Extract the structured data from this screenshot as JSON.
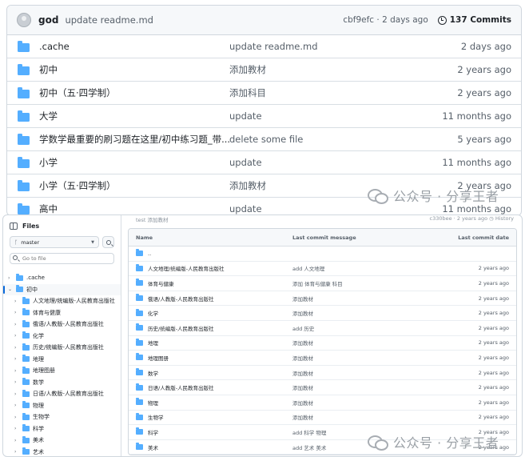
{
  "top": {
    "commit": {
      "author": "god",
      "message": "update readme.md",
      "hash_age": "cbf9efc · 2 days ago",
      "commits": "137 Commits"
    },
    "rows": [
      {
        "name": ".cache",
        "message": "update readme.md",
        "date": "2 days ago"
      },
      {
        "name": "初中",
        "message": "添加教材",
        "date": "2 years ago"
      },
      {
        "name": "初中（五·四学制）",
        "message": "添加科目",
        "date": "2 years ago"
      },
      {
        "name": "大学",
        "message": "update",
        "date": "11 months ago"
      },
      {
        "name": "学数学最重要的刷习题在这里/初中练习题_带...",
        "message": "delete some file",
        "date": "5 years ago"
      },
      {
        "name": "小学",
        "message": "update",
        "date": "11 months ago"
      },
      {
        "name": "小学（五·四学制）",
        "message": "添加教材",
        "date": "2 years ago"
      },
      {
        "name": "高中",
        "message": "update",
        "date": "11 months ago"
      }
    ]
  },
  "watermark": {
    "text": "公众号 · 分享王者"
  },
  "bottom": {
    "sidebar": {
      "title": "Files",
      "branch": "master",
      "goto_placeholder": "Go to file",
      "tree": [
        {
          "label": ".cache",
          "level": 0,
          "open": false
        },
        {
          "label": "初中",
          "level": 0,
          "open": true
        },
        {
          "label": "人文地理/统编版-人民教育出版社",
          "level": 1
        },
        {
          "label": "体育与健康",
          "level": 1
        },
        {
          "label": "俄语/人教版-人民教育出版社",
          "level": 1
        },
        {
          "label": "化学",
          "level": 1
        },
        {
          "label": "历史/统编版-人民教育出版社",
          "level": 1
        },
        {
          "label": "地理",
          "level": 1
        },
        {
          "label": "地理图册",
          "level": 1
        },
        {
          "label": "数学",
          "level": 1
        },
        {
          "label": "日语/人教版-人民教育出版社",
          "level": 1
        },
        {
          "label": "物理",
          "level": 1
        },
        {
          "label": "生物学",
          "level": 1
        },
        {
          "label": "科学",
          "level": 1
        },
        {
          "label": "美术",
          "level": 1
        },
        {
          "label": "艺术",
          "level": 1
        }
      ]
    },
    "strip": {
      "left": "test  添加教材",
      "right": "c330bee · 2 years ago  ◷ History"
    },
    "table": {
      "headers": {
        "name": "Name",
        "message": "Last commit message",
        "date": "Last commit date"
      },
      "rows": [
        {
          "name": "..",
          "message": "",
          "date": ""
        },
        {
          "name": "人文地理/统编版-人民教育出版社",
          "message": "add 人文地理",
          "date": "2 years ago"
        },
        {
          "name": "体育与健康",
          "message": "添加 体育与健康 科目",
          "date": "2 years ago"
        },
        {
          "name": "俄语/人教版-人民教育出版社",
          "message": "添加教材",
          "date": "2 years ago"
        },
        {
          "name": "化学",
          "message": "添加教材",
          "date": "2 years ago"
        },
        {
          "name": "历史/统编版-人民教育出版社",
          "message": "add 历史",
          "date": "2 years ago"
        },
        {
          "name": "地理",
          "message": "添加教材",
          "date": "2 years ago"
        },
        {
          "name": "地理图册",
          "message": "添加教材",
          "date": "2 years ago"
        },
        {
          "name": "数学",
          "message": "添加教材",
          "date": "2 years ago"
        },
        {
          "name": "日语/人教版-人民教育出版社",
          "message": "添加教材",
          "date": "2 years ago"
        },
        {
          "name": "物理",
          "message": "添加教材",
          "date": "2 years ago"
        },
        {
          "name": "生物学",
          "message": "添加教材",
          "date": "2 years ago"
        },
        {
          "name": "科学",
          "message": "add 科学 物理",
          "date": "2 years ago"
        },
        {
          "name": "美术",
          "message": "add 艺术 美术",
          "date": "2 years ago"
        }
      ]
    }
  }
}
